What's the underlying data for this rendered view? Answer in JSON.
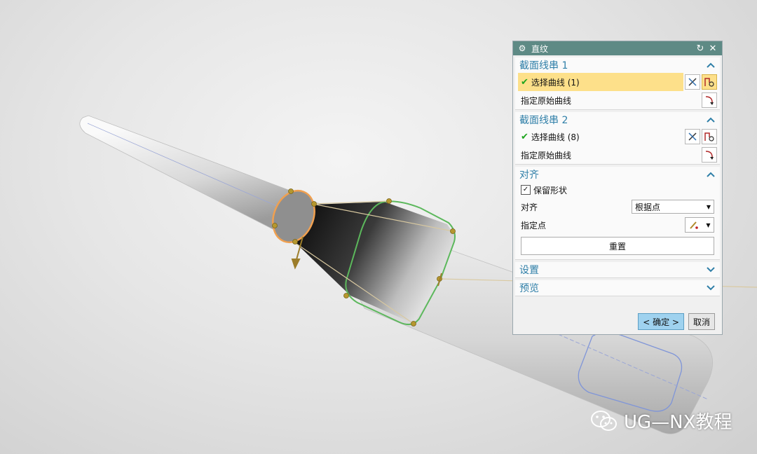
{
  "dialog": {
    "title": "直纹",
    "reset_icon": "↻",
    "close_icon": "✕",
    "section1": {
      "title": "截面线串 1",
      "select_label": "选择曲线 (1)",
      "origin_label": "指定原始曲线"
    },
    "section2": {
      "title": "截面线串 2",
      "select_label": "选择曲线 (8)",
      "origin_label": "指定原始曲线"
    },
    "align": {
      "title": "对齐",
      "keep_shape_label": "保留形状",
      "keep_shape_checked": true,
      "align_label": "对齐",
      "align_value": "根据点",
      "point_label": "指定点",
      "reset_label": "重置"
    },
    "settings": {
      "title": "设置"
    },
    "preview": {
      "title": "预览"
    },
    "ok_label": "< 确定 >",
    "cancel_label": "取消"
  },
  "watermark": {
    "text": "UG—NX教程"
  },
  "colors": {
    "titlebar": "#5e8a85",
    "section_title": "#2f7fa8",
    "highlight": "#fde08a",
    "ok_button": "#9fd2ef",
    "curve_orange": "#f0a050",
    "curve_green": "#5cb85c",
    "curve_blue": "#7f95d8"
  }
}
